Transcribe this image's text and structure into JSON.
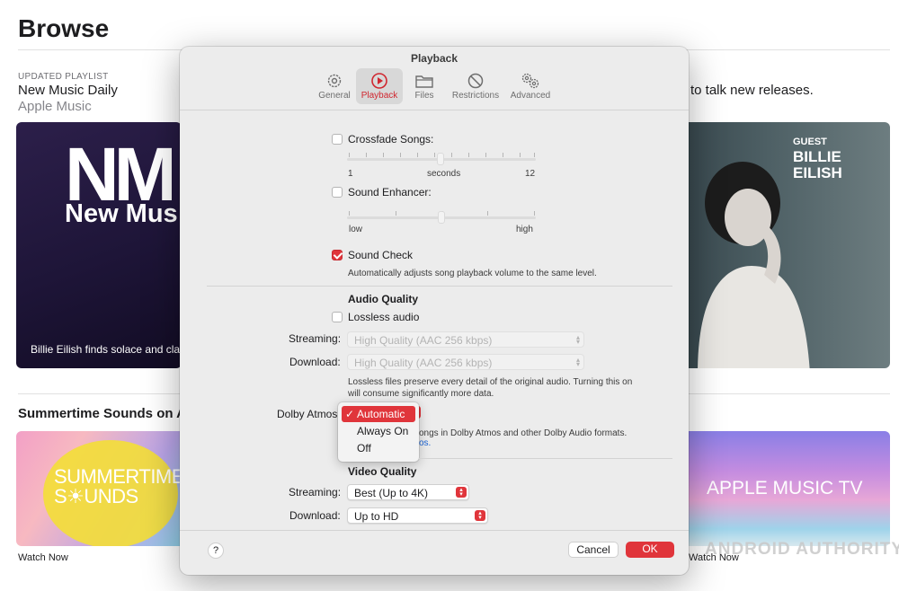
{
  "browse": {
    "title": "Browse",
    "playlist_eyebrow": "UPDATED PLAYLIST",
    "playlist_title": "New Music Daily",
    "playlist_subtitle": "Apple Music",
    "right_text": "to talk new releases.",
    "nm_logo": "NM",
    "nm_big": "New Mus",
    "nm_caption": "Billie Eilish finds solace and clar",
    "guest_label": "GUEST",
    "guest_name_1": "BILLIE",
    "guest_name_2": "EILISH",
    "summer_heading": "Summertime Sounds on A",
    "summer_line1": "SUMMERTIME",
    "summer_line2": "S☀UNDS",
    "watch_now_1": "Watch Now",
    "atv_text": "APPLE MUSIC TV",
    "watch_now_2": "Watch Now",
    "watermark": "ANDROID AUTHORITY"
  },
  "dialog": {
    "title": "Playback",
    "tabs": [
      {
        "label": "General",
        "icon": "gear-icon"
      },
      {
        "label": "Playback",
        "icon": "play-circle-icon"
      },
      {
        "label": "Files",
        "icon": "folder-icon"
      },
      {
        "label": "Restrictions",
        "icon": "prohibited-icon"
      },
      {
        "label": "Advanced",
        "icon": "gears-icon"
      }
    ],
    "active_tab": "Playback",
    "crossfade": {
      "label": "Crossfade Songs:",
      "checked": false,
      "min": "1",
      "unit": "seconds",
      "max": "12",
      "value": 6
    },
    "enhancer": {
      "label": "Sound Enhancer:",
      "checked": false,
      "low": "low",
      "high": "high",
      "value": 0.5
    },
    "sound_check": {
      "label": "Sound Check",
      "checked": true,
      "desc": "Automatically adjusts song playback volume to the same level."
    },
    "audio_quality": {
      "heading": "Audio Quality",
      "lossless_label": "Lossless audio",
      "lossless_checked": false,
      "streaming_label": "Streaming:",
      "streaming_value": "High Quality (AAC 256 kbps)",
      "download_label": "Download:",
      "download_value": "High Quality (AAC 256 kbps)",
      "lossless_desc_1": "Lossless files preserve every detail of the original audio. Turning this on",
      "lossless_desc_2": "will consume significantly more data.",
      "dolby_label": "Dolby Atmos:",
      "dolby_options": [
        "Automatic",
        "Always On",
        "Off"
      ],
      "dolby_selected": "Automatic",
      "dolby_desc_1": "ongs in Dolby Atmos and other Dolby Audio formats.",
      "dolby_desc_link": "os."
    },
    "video_quality": {
      "heading": "Video Quality",
      "streaming_label": "Streaming:",
      "streaming_value": "Best (Up to 4K)",
      "download_label": "Download:",
      "download_value": "Up to HD"
    },
    "help": "?",
    "cancel": "Cancel",
    "ok": "OK",
    "colors": {
      "accent": "#e0353b",
      "window": "#ececec"
    }
  }
}
